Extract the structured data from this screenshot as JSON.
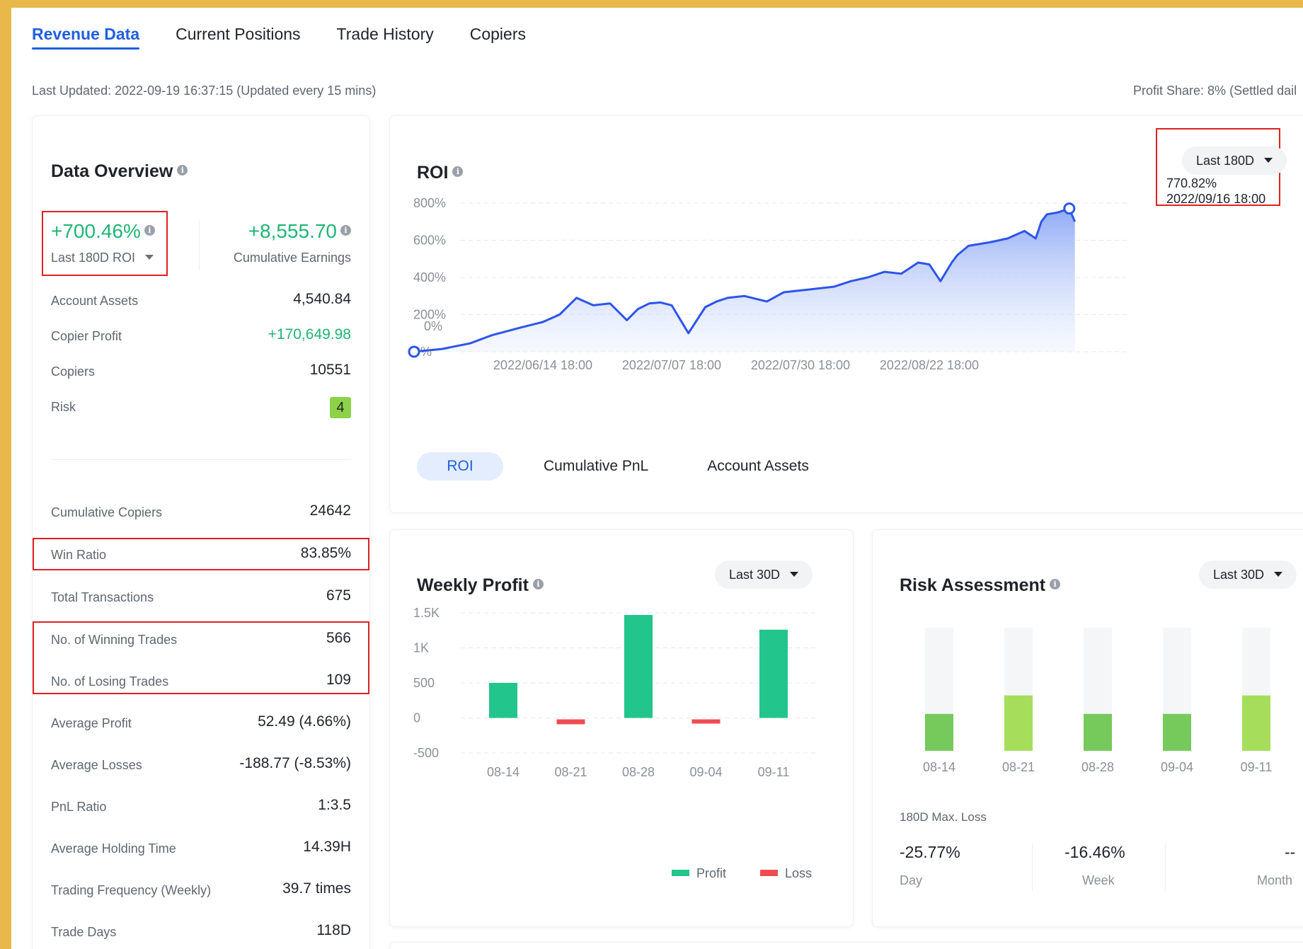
{
  "tabs": [
    {
      "label": "Revenue Data",
      "active": true
    },
    {
      "label": "Current Positions",
      "active": false
    },
    {
      "label": "Trade History",
      "active": false
    },
    {
      "label": "Copiers",
      "active": false
    }
  ],
  "header": {
    "last_updated": "Last Updated: 2022-09-19 16:37:15 (Updated every 15 mins)",
    "profit_share": "Profit Share: 8% (Settled dail"
  },
  "overview": {
    "title": "Data Overview",
    "roi_value": "+700.46%",
    "roi_label": "Last 180D ROI",
    "earnings_value": "+8,555.70",
    "earnings_label": "Cumulative Earnings",
    "stats": [
      {
        "label": "Account Assets",
        "value": "4,540.84"
      },
      {
        "label": "Copier Profit",
        "value": "+170,649.98"
      },
      {
        "label": "Copiers",
        "value": "10551"
      },
      {
        "label": "Risk",
        "value": "4"
      },
      {
        "label": "Cumulative Copiers",
        "value": "24642"
      },
      {
        "label": "Win Ratio",
        "value": "83.85%"
      },
      {
        "label": "Total Transactions",
        "value": "675"
      },
      {
        "label": "No. of Winning Trades",
        "value": "566"
      },
      {
        "label": "No. of Losing Trades",
        "value": "109"
      },
      {
        "label": "Average Profit",
        "value": "52.49 (4.66%)"
      },
      {
        "label": "Average Losses",
        "value": "-188.77 (-8.53%)"
      },
      {
        "label": "PnL Ratio",
        "value": "1:3.5"
      },
      {
        "label": "Average Holding Time",
        "value": "14.39H"
      },
      {
        "label": "Trading Frequency (Weekly)",
        "value": "39.7 times"
      },
      {
        "label": "Trade Days",
        "value": "118D"
      }
    ]
  },
  "roi_chart": {
    "title": "ROI",
    "range_label": "Last 180D",
    "tooltip_value": "770.82%",
    "tooltip_time": "2022/09/16 18:00",
    "sub_tabs": [
      {
        "label": "ROI",
        "active": true
      },
      {
        "label": "Cumulative PnL",
        "active": false
      },
      {
        "label": "Account Assets",
        "active": false
      }
    ]
  },
  "weekly": {
    "title": "Weekly Profit",
    "range_label": "Last 30D",
    "legend_profit": "Profit",
    "legend_loss": "Loss"
  },
  "risk": {
    "title": "Risk Assessment",
    "range_label": "Last 30D",
    "max_loss_label": "180D Max. Loss",
    "day_value": "-25.77%",
    "day_label": "Day",
    "week_value": "-16.46%",
    "week_label": "Week",
    "month_value": "--",
    "month_label": "Month"
  },
  "colors": {
    "accent": "#1f5fe0",
    "profit": "#22c58b",
    "loss": "#f04b55",
    "risk_green": "#76c95b",
    "risk_lime": "#a6de5c",
    "positive_text": "#1fb574"
  },
  "chart_data": [
    {
      "type": "area",
      "series": [
        {
          "x": [
            "2022/05/22",
            "2022/05/27",
            "2022/06/01",
            "2022/06/05",
            "2022/06/10",
            "2022/06/14",
            "2022/06/17",
            "2022/06/20",
            "2022/06/23",
            "2022/06/26",
            "2022/06/29",
            "2022/07/01",
            "2022/07/03",
            "2022/07/05",
            "2022/07/07",
            "2022/07/10",
            "2022/07/13",
            "2022/07/15",
            "2022/07/16",
            "2022/07/17",
            "2022/07/20",
            "2022/07/24",
            "2022/07/27",
            "2022/07/30",
            "2022/08/02",
            "2022/08/05",
            "2022/08/08",
            "2022/08/11",
            "2022/08/14",
            "2022/08/17",
            "2022/08/20",
            "2022/08/22",
            "2022/08/24",
            "2022/08/26",
            "2022/08/27",
            "2022/08/29",
            "2022/09/02",
            "2022/09/05",
            "2022/09/08",
            "2022/09/10",
            "2022/09/11",
            "2022/09/12",
            "2022/09/14",
            "2022/09/16",
            "2022/09/17"
          ],
          "y": [
            0,
            15,
            45,
            90,
            130,
            160,
            200,
            290,
            250,
            260,
            170,
            230,
            260,
            265,
            250,
            100,
            240,
            270,
            280,
            290,
            300,
            270,
            320,
            330,
            340,
            350,
            380,
            400,
            430,
            420,
            480,
            470,
            380,
            480,
            520,
            570,
            590,
            610,
            650,
            610,
            700,
            740,
            750,
            770.82,
            700
          ]
        }
      ],
      "xticks": [
        "2022/06/14 18:00",
        "2022/07/07 18:00",
        "2022/07/30 18:00",
        "2022/08/22 18:00"
      ],
      "yticks": [
        "0%",
        "200%",
        "400%",
        "600%",
        "800%"
      ],
      "ylim": [
        0,
        800
      ],
      "annotations": [
        {
          "label": "0%",
          "x": "2022/05/22",
          "y": 0
        },
        {
          "label": "770.82%",
          "x": "2022/09/16",
          "y": 770.82
        }
      ],
      "grid": true
    },
    {
      "type": "bar",
      "categories": [
        "08-14",
        "08-21",
        "08-28",
        "09-04",
        "09-11"
      ],
      "series": [
        {
          "name": "Profit",
          "values": [
            500,
            0,
            1470,
            0,
            1260
          ]
        },
        {
          "name": "Loss",
          "values": [
            0,
            -70,
            0,
            -60,
            0
          ]
        }
      ],
      "yticks": [
        "-500",
        "0",
        "500",
        "1K",
        "1.5K"
      ],
      "ylim": [
        -500,
        1500
      ],
      "legend": "bottom-right",
      "grid": true
    },
    {
      "type": "bar",
      "categories": [
        "08-14",
        "08-21",
        "08-28",
        "09-04",
        "09-11"
      ],
      "values": [
        0.3,
        0.45,
        0.3,
        0.3,
        0.45
      ],
      "ylim": [
        0,
        1
      ],
      "grid": false
    }
  ]
}
